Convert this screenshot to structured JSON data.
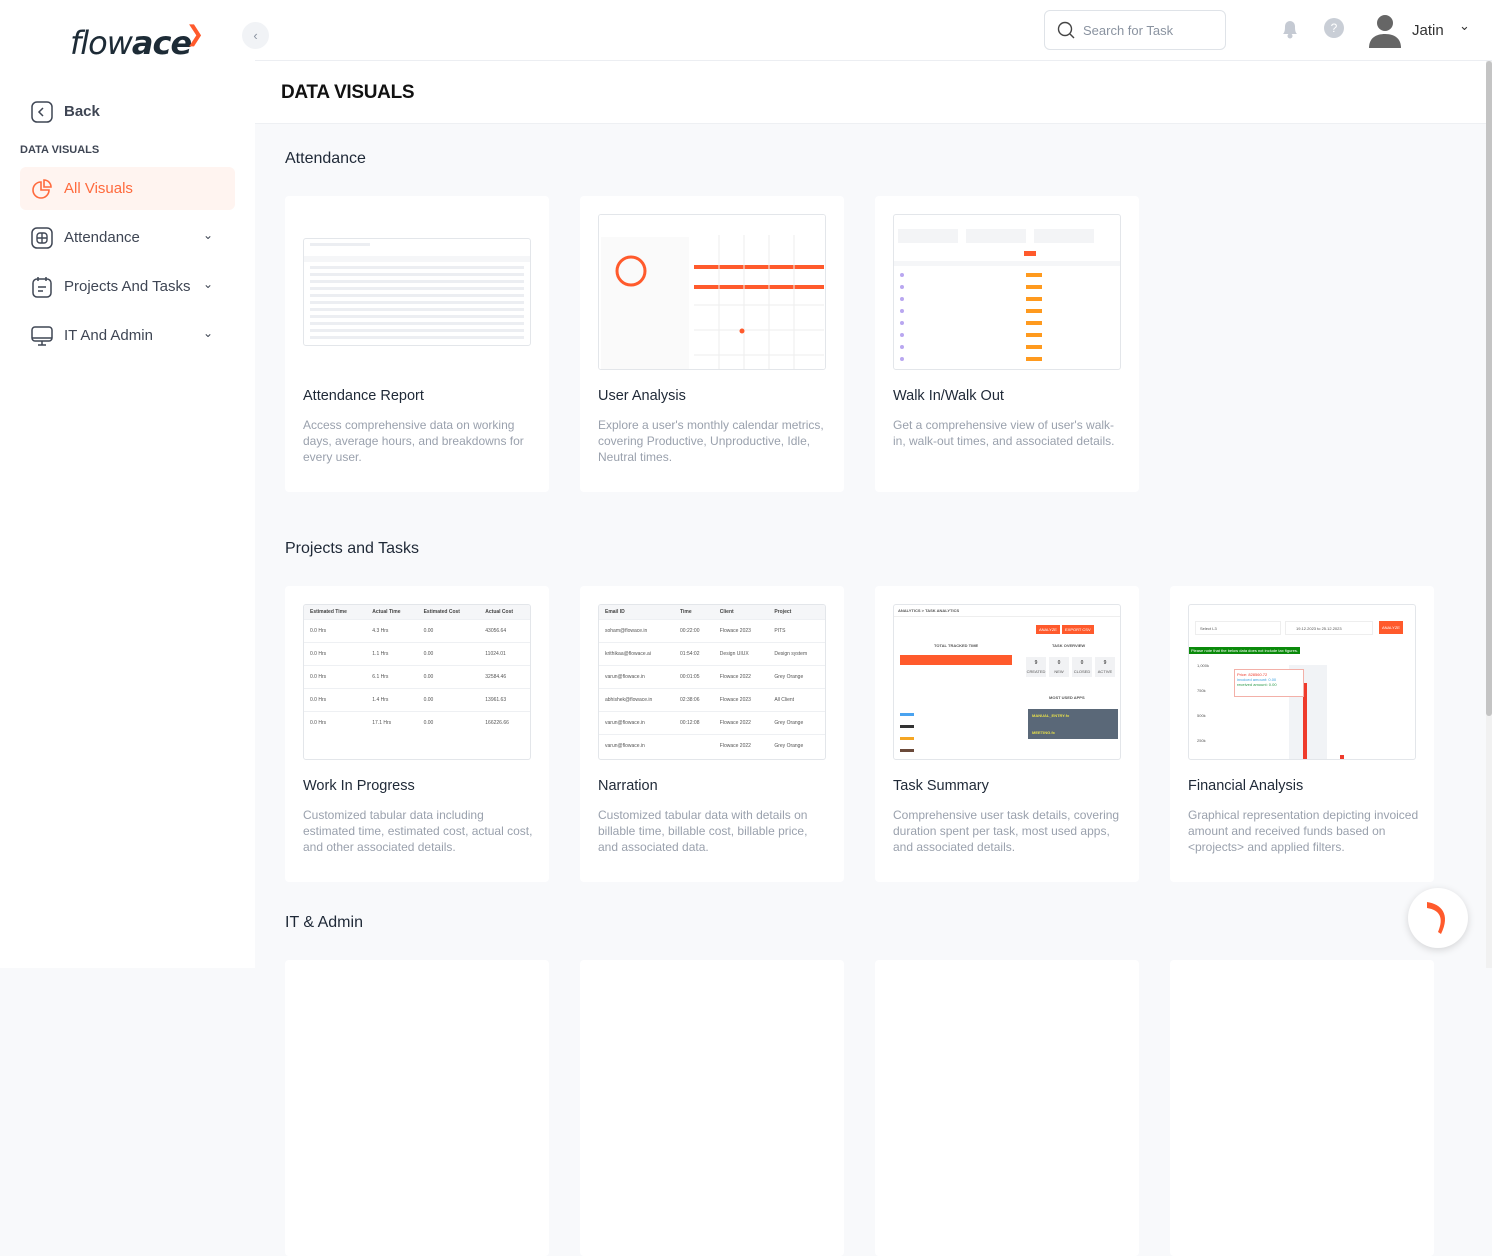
{
  "app": {
    "logo_light": "flow",
    "logo_bold": "ace"
  },
  "sidebar": {
    "back": "Back",
    "section": "DATA VISUALS",
    "items": [
      {
        "label": "All Visuals",
        "active": true,
        "icon": "pie-chart-icon"
      },
      {
        "label": "Attendance",
        "icon": "grid-icon"
      },
      {
        "label": "Projects And Tasks",
        "icon": "clipboard-icon"
      },
      {
        "label": "IT And Admin",
        "icon": "monitor-icon"
      }
    ]
  },
  "header": {
    "search_placeholder": "Search for Task",
    "user": "Jatin",
    "help": "?"
  },
  "page": {
    "title": "DATA VISUALS"
  },
  "colors": {
    "accent": "#ff6a3d",
    "accent_bg": "#fff4f0"
  },
  "sections": [
    {
      "title": "Attendance",
      "cards": [
        {
          "title": "Attendance Report",
          "desc": "Access comprehensive data on working days, average hours, and breakdowns for every user."
        },
        {
          "title": "User Analysis",
          "desc": "Explore a user's monthly calendar metrics, covering Productive, Unproductive, Idle, Neutral times."
        },
        {
          "title": "Walk In/Walk Out",
          "desc": "Get a comprehensive view of user's walk-in, walk-out times, and associated details."
        }
      ]
    },
    {
      "title": "Projects and Tasks",
      "cards": [
        {
          "title": "Work In Progress",
          "desc": "Customized tabular data including estimated time, estimated cost, actual cost, and other associated details."
        },
        {
          "title": "Narration",
          "desc": "Customized tabular data with details on billable time, billable cost, billable price, and associated data."
        },
        {
          "title": "Task Summary",
          "desc": "Comprehensive user task details, covering duration spent per task, most used apps, and associated details."
        },
        {
          "title": "Financial Analysis",
          "desc": "Graphical representation depicting invoiced amount and received funds based on <projects> and applied filters."
        }
      ]
    },
    {
      "title": "IT & Admin",
      "cards": []
    }
  ],
  "thumbs": {
    "wip": {
      "headers": [
        "Estimated Time",
        "Actual Time",
        "Estimated Cost",
        "Actual Cost"
      ],
      "rows": [
        [
          "0.0 Hrs",
          "4.3 Hrs",
          "0.00",
          "43056.64"
        ],
        [
          "0.0 Hrs",
          "1.1 Hrs",
          "0.00",
          "11024.01"
        ],
        [
          "0.0 Hrs",
          "6.1 Hrs",
          "0.00",
          "32584.46"
        ],
        [
          "0.0 Hrs",
          "1.4 Hrs",
          "0.00",
          "13961.63"
        ],
        [
          "0.0 Hrs",
          "17.1 Hrs",
          "0.00",
          "166226.66"
        ]
      ]
    },
    "narration": {
      "headers": [
        "Email ID",
        "Time",
        "Client",
        "Project"
      ],
      "rows": [
        [
          "soham@flowace.in",
          "00:22:00",
          "Flowace 2023",
          "PITS"
        ],
        [
          "krithikaa@flowace.ai",
          "01:54:02",
          "Design UIUX",
          "Design system"
        ],
        [
          "varun@flowace.in",
          "00:01:05",
          "Flowace 2022",
          "Grey Orange"
        ],
        [
          "abhishek@flowace.in",
          "02:38:06",
          "Flowace 2023",
          "All Client"
        ],
        [
          "varun@flowace.in",
          "00:12:08",
          "Flowace 2022",
          "Grey Orange"
        ],
        [
          "varun@flowace.in",
          "",
          "Flowace 2022",
          "Grey Orange"
        ]
      ]
    },
    "task": {
      "heading": "ANALYTICS > TASK ANALYTICS",
      "analyze": "ANALYZE",
      "export": "EXPORT CSV",
      "tracked": "TOTAL TRACKED TIME",
      "overview": "TASK OVERVIEW",
      "stats": [
        [
          "9",
          "CREATED"
        ],
        [
          "0",
          "NEW"
        ],
        [
          "0",
          "CLOSED"
        ],
        [
          "9",
          "ACTIVE"
        ]
      ],
      "apps": "MOST USED APPS",
      "app_rows": [
        "MANUAL_ENTRY.fx",
        "MEETING.fx"
      ]
    },
    "finance": {
      "select": "Select L3",
      "dates": "19.12.2023 to 25.12.2023",
      "analyze": "ANALYZE",
      "note": "Please note that the below data does not include tax figures.",
      "ticks": [
        "1,000k",
        "750k",
        "500k",
        "250k"
      ],
      "price": "828560.72",
      "invoiced": "0.00",
      "received": "0.00"
    }
  }
}
